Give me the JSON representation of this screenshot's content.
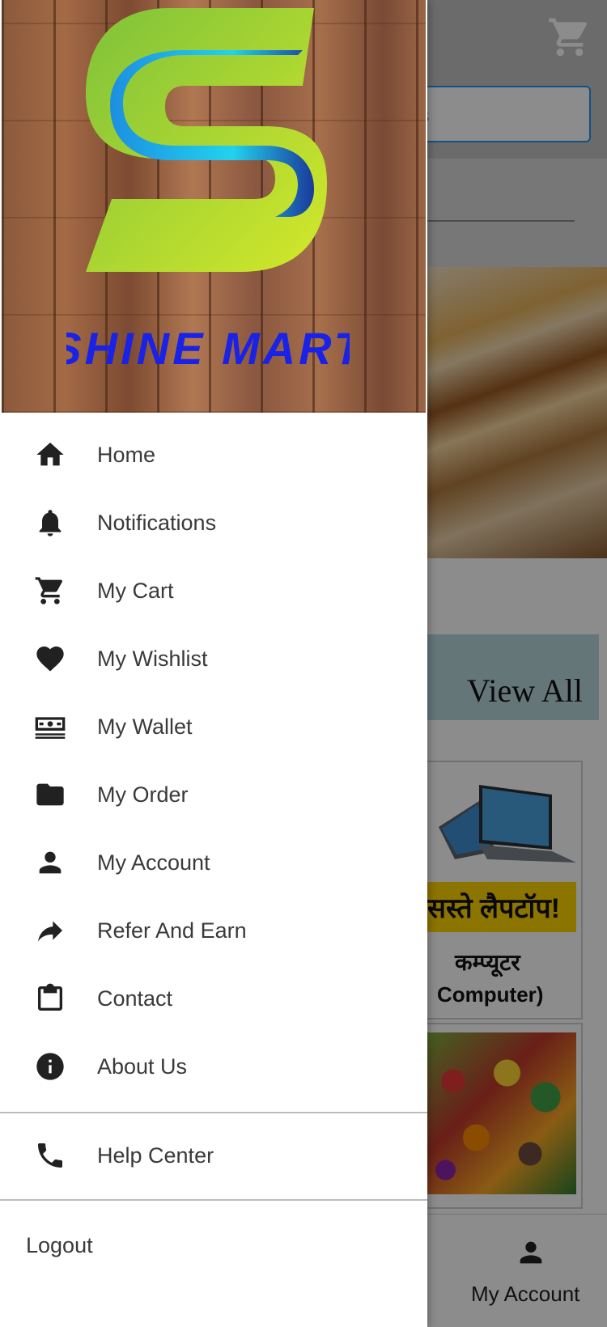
{
  "background": {
    "search_placeholder_fragment": "ıs",
    "view_all_label": "View All",
    "card_hindi_banner": "सस्ते लैपटॉप!",
    "card_hindi_title": "कम्प्यूटर",
    "card_title": "Computer)",
    "bottom_nav_account": "My Account"
  },
  "drawer": {
    "brand_text": "SHINE MART",
    "items": [
      {
        "label": "Home",
        "icon": "home-icon"
      },
      {
        "label": "Notifications",
        "icon": "bell-icon"
      },
      {
        "label": "My Cart",
        "icon": "cart-icon"
      },
      {
        "label": "My Wishlist",
        "icon": "heart-icon"
      },
      {
        "label": "My Wallet",
        "icon": "wallet-icon"
      },
      {
        "label": "My Order",
        "icon": "folder-icon"
      },
      {
        "label": "My Account",
        "icon": "person-icon"
      },
      {
        "label": "Refer And Earn",
        "icon": "share-icon"
      },
      {
        "label": "Contact",
        "icon": "clipboard-icon"
      },
      {
        "label": "About Us",
        "icon": "info-icon"
      }
    ],
    "help": {
      "label": "Help Center",
      "icon": "phone-icon"
    },
    "logout_label": "Logout"
  },
  "colors": {
    "brand_blue": "#1a22e6",
    "logo_green": "#9acd32",
    "logo_blue": "#1ec8e8",
    "accent_border": "#2196f3"
  }
}
